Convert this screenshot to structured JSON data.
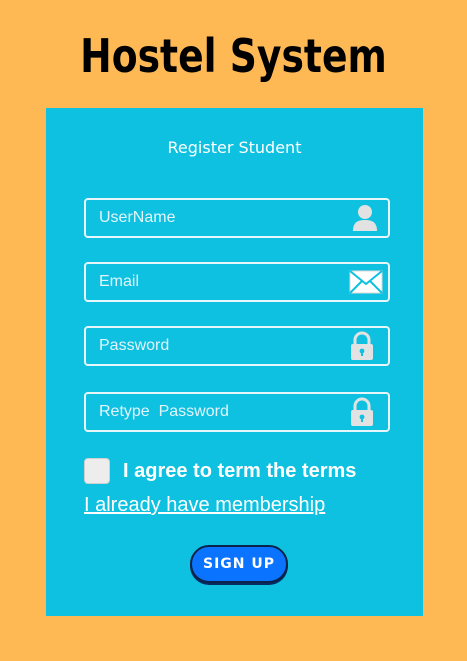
{
  "header": {
    "title": "Hostel System"
  },
  "form": {
    "title": "Register Student",
    "fields": {
      "username": {
        "placeholder": "UserName",
        "value": "",
        "icon": "user-icon"
      },
      "email": {
        "placeholder": "Email",
        "value": "",
        "icon": "envelope-icon"
      },
      "password": {
        "placeholder": "Password",
        "value": "",
        "icon": "lock-icon"
      },
      "retype_password": {
        "placeholder": "Retype  Password",
        "value": "",
        "icon": "lock-icon"
      }
    },
    "agree": {
      "label": "I agree to term the terms",
      "checked": false
    },
    "membership_link": "I already have membership",
    "submit_label": "SIGN UP"
  },
  "colors": {
    "background": "#FEB955",
    "card": "#0EC1E0",
    "button": "#0A73FF",
    "text_light": "#FFFFFF"
  }
}
